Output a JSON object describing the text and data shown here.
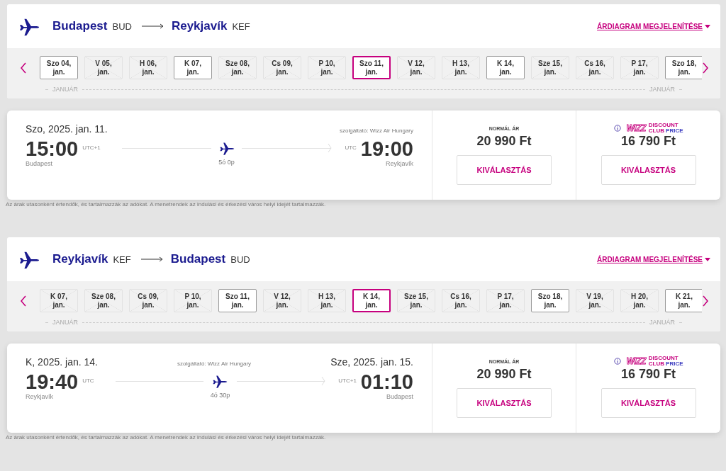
{
  "journeys": [
    {
      "origin_city": "Budapest",
      "origin_code": "BUD",
      "destination_city": "Reykjavík",
      "destination_code": "KEF",
      "price_chart_link": "ÁRDIAGRAM MEGJELENÍTÉSE",
      "month_labels": [
        "JANUÁR",
        "JANUÁR"
      ],
      "dates": [
        {
          "day": "Szo 04,",
          "month": "jan.",
          "available": true,
          "selected": false
        },
        {
          "day": "V 05,",
          "month": "jan.",
          "available": false,
          "selected": false
        },
        {
          "day": "H 06,",
          "month": "jan.",
          "available": false,
          "selected": false
        },
        {
          "day": "K 07,",
          "month": "jan.",
          "available": true,
          "selected": false
        },
        {
          "day": "Sze 08,",
          "month": "jan.",
          "available": false,
          "selected": false
        },
        {
          "day": "Cs 09,",
          "month": "jan.",
          "available": false,
          "selected": false
        },
        {
          "day": "P 10,",
          "month": "jan.",
          "available": false,
          "selected": false
        },
        {
          "day": "Szo 11,",
          "month": "jan.",
          "available": true,
          "selected": true
        },
        {
          "day": "V 12,",
          "month": "jan.",
          "available": false,
          "selected": false
        },
        {
          "day": "H 13,",
          "month": "jan.",
          "available": false,
          "selected": false
        },
        {
          "day": "K 14,",
          "month": "jan.",
          "available": true,
          "selected": false
        },
        {
          "day": "Sze 15,",
          "month": "jan.",
          "available": false,
          "selected": false
        },
        {
          "day": "Cs 16,",
          "month": "jan.",
          "available": false,
          "selected": false
        },
        {
          "day": "P 17,",
          "month": "jan.",
          "available": false,
          "selected": false
        },
        {
          "day": "Szo 18,",
          "month": "jan.",
          "available": true,
          "selected": false
        }
      ],
      "flight": {
        "departure_date": "Szo, 2025. jan. 11.",
        "operator": "szolgáltató: Wizz Air Hungary",
        "departure_time": "15:00",
        "departure_tz": "UTC+1",
        "duration": "5ó 0p",
        "arrival_tz": "UTC",
        "arrival_time": "19:00",
        "departure_city": "Budapest",
        "arrival_city": "Reykjavík"
      },
      "fares": [
        {
          "kind": "normal",
          "label": "NORMÁL ÁR",
          "price": "20 990 Ft",
          "button": "KIVÁLASZTÁS"
        },
        {
          "kind": "club",
          "logo_word": "WIZZ",
          "badge": [
            "DISCOUNT",
            "CLUB",
            "PRICE"
          ],
          "price": "16 790 Ft",
          "button": "KIVÁLASZTÁS"
        }
      ],
      "disclaimer": "Az árak utasonként értendők, és tartalmazzák az adókat. A menetrendek az indulási és érkezési város helyi idejét tartalmazzák."
    },
    {
      "origin_city": "Reykjavík",
      "origin_code": "KEF",
      "destination_city": "Budapest",
      "destination_code": "BUD",
      "price_chart_link": "ÁRDIAGRAM MEGJELENÍTÉSE",
      "month_labels": [
        "JANUÁR",
        "JANUÁR"
      ],
      "dates": [
        {
          "day": "K 07,",
          "month": "jan.",
          "available": false,
          "selected": false
        },
        {
          "day": "Sze 08,",
          "month": "jan.",
          "available": false,
          "selected": false
        },
        {
          "day": "Cs 09,",
          "month": "jan.",
          "available": false,
          "selected": false
        },
        {
          "day": "P 10,",
          "month": "jan.",
          "available": false,
          "selected": false
        },
        {
          "day": "Szo 11,",
          "month": "jan.",
          "available": true,
          "selected": false
        },
        {
          "day": "V 12,",
          "month": "jan.",
          "available": false,
          "selected": false
        },
        {
          "day": "H 13,",
          "month": "jan.",
          "available": false,
          "selected": false
        },
        {
          "day": "K 14,",
          "month": "jan.",
          "available": true,
          "selected": true
        },
        {
          "day": "Sze 15,",
          "month": "jan.",
          "available": false,
          "selected": false
        },
        {
          "day": "Cs 16,",
          "month": "jan.",
          "available": false,
          "selected": false
        },
        {
          "day": "P 17,",
          "month": "jan.",
          "available": false,
          "selected": false
        },
        {
          "day": "Szo 18,",
          "month": "jan.",
          "available": true,
          "selected": false
        },
        {
          "day": "V 19,",
          "month": "jan.",
          "available": false,
          "selected": false
        },
        {
          "day": "H 20,",
          "month": "jan.",
          "available": false,
          "selected": false
        },
        {
          "day": "K 21,",
          "month": "jan.",
          "available": true,
          "selected": false
        }
      ],
      "flight": {
        "departure_date": "K, 2025. jan. 14.",
        "operator": "szolgáltató: Wizz Air Hungary",
        "arrival_date": "Sze, 2025. jan. 15.",
        "departure_time": "19:40",
        "departure_tz": "UTC",
        "duration": "4ó 30p",
        "arrival_tz": "UTC+1",
        "arrival_time": "01:10",
        "departure_city": "Reykjavík",
        "arrival_city": "Budapest"
      },
      "fares": [
        {
          "kind": "normal",
          "label": "NORMÁL ÁR",
          "price": "20 990 Ft",
          "button": "KIVÁLASZTÁS"
        },
        {
          "kind": "club",
          "logo_word": "WIZZ",
          "badge": [
            "DISCOUNT",
            "CLUB",
            "PRICE"
          ],
          "price": "16 790 Ft",
          "button": "KIVÁLASZTÁS"
        }
      ],
      "disclaimer": "Az árak utasonként értendők, és tartalmazzák az adókat. A menetrendek az indulási és érkezési város helyi idejét tartalmazzák."
    }
  ]
}
